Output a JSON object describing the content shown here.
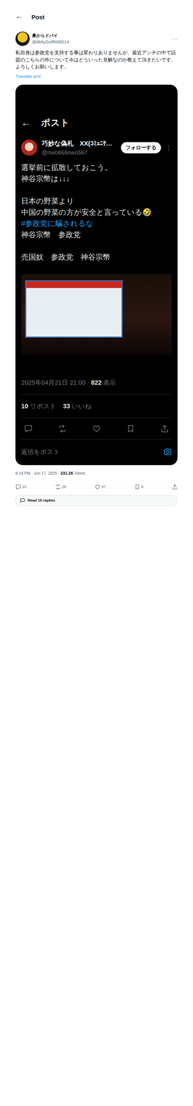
{
  "header": {
    "back": "←",
    "title": "Post"
  },
  "author": {
    "name": "鼻からドバイ",
    "handle": "@i8k6yGo9fW99214",
    "more": "···"
  },
  "text": "私自身は参政党を支持する事は変わりありませんが、最近アンチの中で話題のこちらの件について今はどういった見解なのか教えて頂きたいです。よろしくお願いします。",
  "translate": "Translate post",
  "embedded": {
    "header": {
      "back": "←",
      "title": "ポスト"
    },
    "author": {
      "name": "巧妙な偽札　XX(ｺﾐｭﾆｹ…",
      "handle": "@nwo666nwo567",
      "follow": "フォローする",
      "more": "⋮"
    },
    "groups": [
      [
        {
          "kind": "text",
          "text": "選挙前に拡散しておこう。"
        },
        {
          "kind": "text",
          "text": "神谷宗幣は↓↓↓"
        }
      ],
      [
        {
          "kind": "text",
          "text": "日本の野菜より"
        },
        {
          "kind": "text",
          "text": "中国の野菜の方が安全と言っている🤣"
        },
        {
          "kind": "hashtag",
          "text": "#参政党に騙されるな"
        },
        {
          "kind": "text",
          "text": "神谷宗幣　参政党"
        }
      ],
      [
        {
          "kind": "text",
          "text": "売国奴　参政党　神谷宗幣"
        }
      ]
    ],
    "meta": {
      "date": "2025年04月21日 21:00 · ",
      "views": "822",
      "views_label": " 表示"
    },
    "stats": [
      {
        "count": "10",
        "label": " リポスト"
      },
      {
        "count": "33",
        "label": " いいね"
      }
    ],
    "actions": [
      {
        "kind": "reply"
      },
      {
        "kind": "repost"
      },
      {
        "kind": "like"
      },
      {
        "kind": "bookmark"
      },
      {
        "kind": "share"
      }
    ],
    "reply_placeholder": "返信をポスト"
  },
  "meta": {
    "time": "6:14 PM · Jun 17, 2025 · ",
    "views": "231.2K",
    "views_label": " Views"
  },
  "actions": [
    {
      "kind": "reply",
      "count": "10"
    },
    {
      "kind": "repost",
      "count": "29"
    },
    {
      "kind": "like",
      "count": "97"
    },
    {
      "kind": "bookmark",
      "count": "8"
    },
    {
      "kind": "share",
      "count": ""
    }
  ],
  "read_replies": "Read 10 replies"
}
